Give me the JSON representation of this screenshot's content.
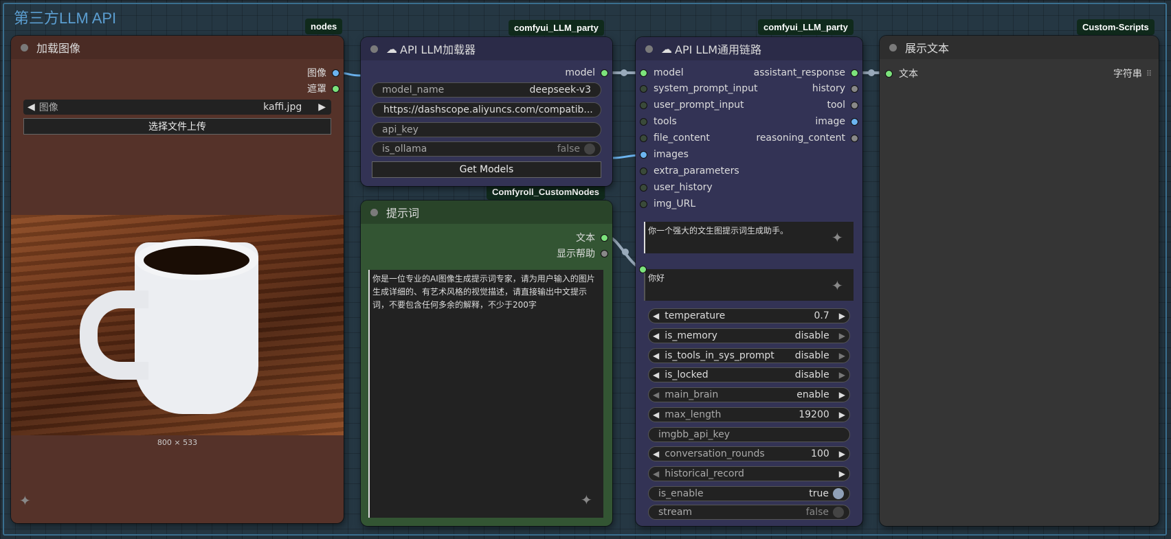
{
  "group": {
    "title": "第三方LLM API"
  },
  "tags": {
    "nodes": "nodes",
    "loader": "comfyui_LLM_party",
    "chain": "comfyui_LLM_party",
    "custom_scripts": "Custom-Scripts",
    "comfyroll": "Comfyroll_CustomNodes"
  },
  "load_image": {
    "title": "加载图像",
    "outputs": [
      "图像",
      "遮罩"
    ],
    "image_label": "图像",
    "image_value": "kaffi.jpg",
    "upload_button": "选择文件上传",
    "dimensions": "800 × 533"
  },
  "api_loader": {
    "title": "API LLM加载器",
    "output": "model",
    "model_name_label": "model_name",
    "model_name_value": "deepseek-v3",
    "base_url": "https://dashscope.aliyuncs.com/compatib...",
    "api_key_label": "api_key",
    "is_ollama_label": "is_ollama",
    "is_ollama_value": "false",
    "get_models_button": "Get Models"
  },
  "prompt_node": {
    "title": "提示词",
    "outputs": [
      "文本",
      "显示帮助"
    ],
    "text": "你是一位专业的AI图像生成提示词专家，请为用户输入的图片生成详细的、有艺术风格的视觉描述，请直接输出中文提示词，不要包含任何多余的解释，不少于200字"
  },
  "chain": {
    "title": "API LLM通用链路",
    "inputs": [
      "model",
      "system_prompt_input",
      "user_prompt_input",
      "tools",
      "file_content",
      "images",
      "extra_parameters",
      "user_history",
      "img_URL"
    ],
    "outputs": [
      "assistant_response",
      "history",
      "tool",
      "image",
      "reasoning_content"
    ],
    "system_prompt": "你一个强大的文生图提示词生成助手。",
    "user_prompt": "你好",
    "widgets": [
      {
        "label": "temperature",
        "value": "0.7"
      },
      {
        "label": "is_memory",
        "value": "disable"
      },
      {
        "label": "is_tools_in_sys_prompt",
        "value": "disable"
      },
      {
        "label": "is_locked",
        "value": "disable"
      },
      {
        "label": "main_brain",
        "value": "enable"
      },
      {
        "label": "max_length",
        "value": "19200"
      },
      {
        "label": "imgbb_api_key",
        "value": ""
      },
      {
        "label": "conversation_rounds",
        "value": "100"
      },
      {
        "label": "historical_record",
        "value": ""
      },
      {
        "label": "is_enable",
        "value": "true"
      },
      {
        "label": "stream",
        "value": "false"
      }
    ]
  },
  "display_text": {
    "title": "展示文本",
    "input": "文本",
    "input_type": "字符串"
  },
  "colors": {
    "load_image_bg": "#553229",
    "api_bg": "#333355",
    "prompt_bg": "#335533",
    "display_bg": "#353535",
    "pin_green": "#7ce37c",
    "pin_blue": "#6cb4f0"
  }
}
